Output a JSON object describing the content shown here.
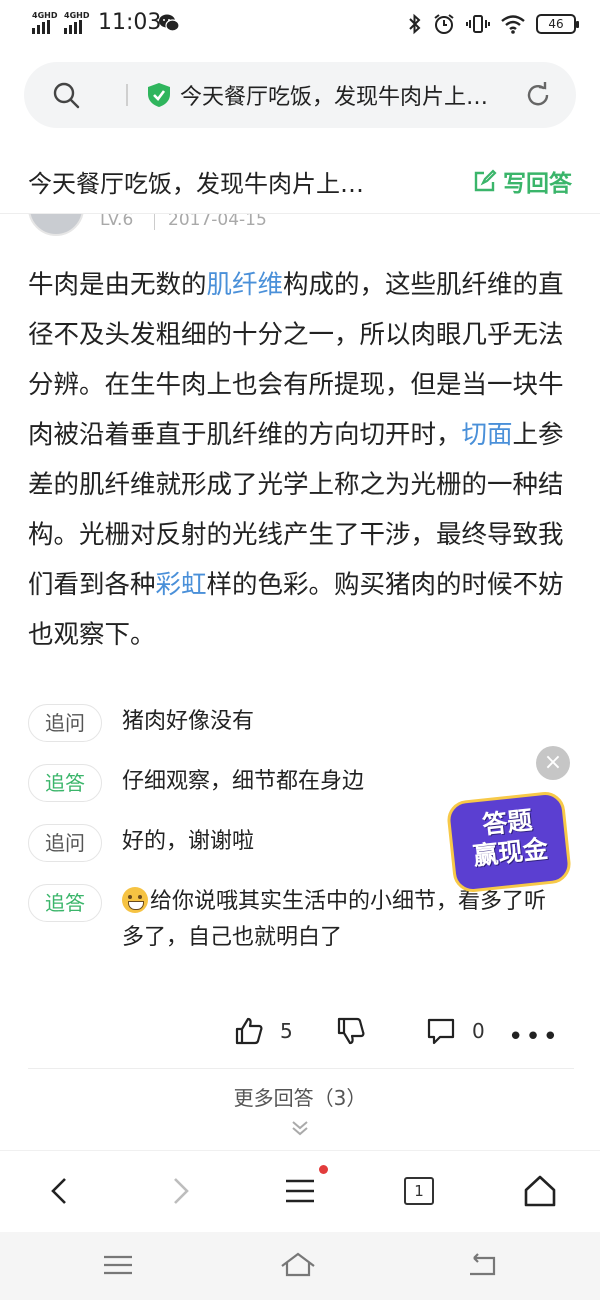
{
  "status_bar": {
    "sim1_label": "4GHD",
    "sim2_label": "4GHD",
    "time": "11:03",
    "battery": "46",
    "icons": [
      "wechat-icon",
      "bluetooth-icon",
      "alarm-icon",
      "vibrate-icon",
      "wifi-icon",
      "battery-icon"
    ]
  },
  "search_bar": {
    "text": "今天餐厅吃饭，发现牛肉片上…",
    "icons": [
      "search-icon",
      "shield-check-icon",
      "refresh-icon"
    ]
  },
  "title_bar": {
    "title": "今天餐厅吃饭，发现牛肉片上…",
    "write_answer_label": "写回答"
  },
  "author": {
    "level": "LV.6",
    "date": "2017-04-15"
  },
  "answer": {
    "p1": "牛肉是由无数的",
    "link1": "肌纤维",
    "p2": "构成的，这些肌纤维的直径不及头发粗细的十分之一，所以肉眼几乎无法分辨。在生牛肉上也会有所提现，但是当一块牛肉被沿着垂直于肌纤维的方向切开时，",
    "link2": "切面",
    "p3": "上参差的肌纤维就形成了光学上称之为光栅的一种结构。光栅对反射的光线产生了干涉，最终导致我们看到各种",
    "link3": "彩虹",
    "p4": "样的色彩。购买猪肉的时候不妨也观察下。"
  },
  "followups": [
    {
      "tag": "追问",
      "text": "猪肉好像没有"
    },
    {
      "tag": "追答",
      "text": "仔细观察，细节都在身边"
    },
    {
      "tag": "追问",
      "text": "好的，谢谢啦"
    },
    {
      "tag": "追答",
      "text": "给你说哦其实生活中的小细节，看多了听多了，自己也就明白了"
    }
  ],
  "promo": {
    "line1": "答题",
    "line2": "赢现金",
    "close": "×"
  },
  "actions": {
    "like_count": "5",
    "comment_count": "0",
    "more": "•••"
  },
  "more_answers": {
    "label": "更多回答（3）"
  },
  "browser_bar": {
    "tab_count": "1"
  },
  "colors": {
    "accent_green": "#3ab56a",
    "link_blue": "#4a90d9"
  }
}
